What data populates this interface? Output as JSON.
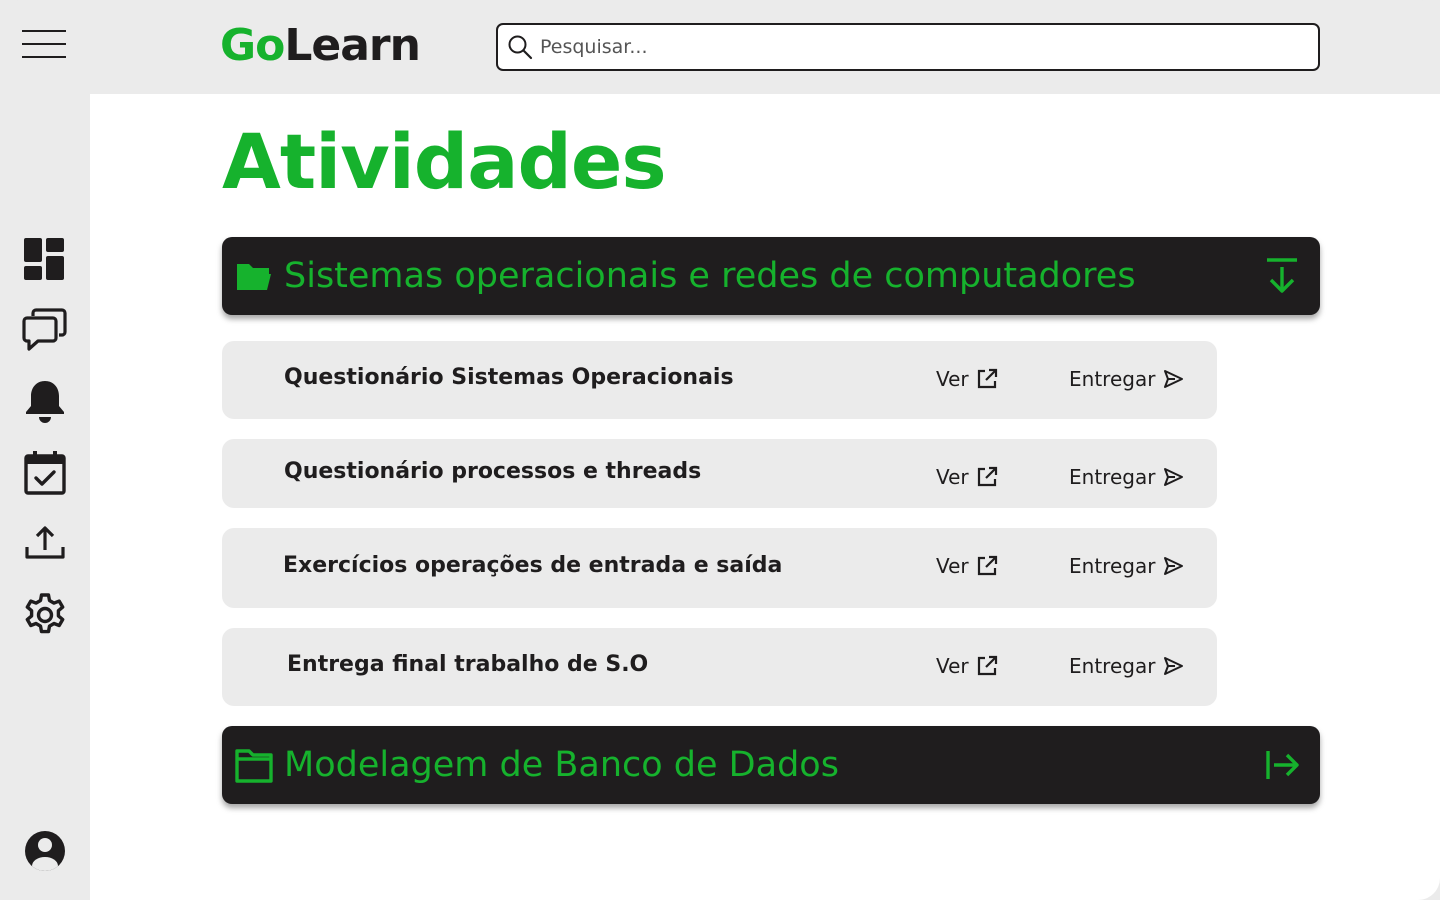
{
  "header": {
    "logo_part1": "Go",
    "logo_part2": "Learn",
    "search_placeholder": "Pesquisar..."
  },
  "sidebar": {
    "items": [
      {
        "name": "dashboard-icon"
      },
      {
        "name": "chat-icon"
      },
      {
        "name": "bell-icon"
      },
      {
        "name": "calendar-check-icon"
      },
      {
        "name": "upload-icon"
      },
      {
        "name": "gear-icon"
      }
    ],
    "profile_icon": "user-icon"
  },
  "main": {
    "title": "Atividades",
    "folders": [
      {
        "label": "Sistemas operacionais e redes de computadores",
        "expanded": true,
        "action_icon": "download-arrow-icon",
        "tasks": [
          {
            "title": "Questionário Sistemas Operacionais",
            "view_label": "Ver",
            "submit_label": "Entregar"
          },
          {
            "title": "Questionário processos e threads",
            "view_label": "Ver",
            "submit_label": "Entregar"
          },
          {
            "title": "Exercícios operações de entrada e saída",
            "view_label": "Ver",
            "submit_label": "Entregar"
          },
          {
            "title": "Entrega final trabalho de S.O",
            "view_label": "Ver",
            "submit_label": "Entregar"
          }
        ]
      },
      {
        "label": "Modelagem de Banco de Dados",
        "expanded": false,
        "action_icon": "arrow-right-to-line-icon"
      }
    ]
  },
  "colors": {
    "accent": "#16b22d",
    "dark": "#1f1d1e",
    "panel": "#ebebeb",
    "surface": "#ffffff"
  }
}
